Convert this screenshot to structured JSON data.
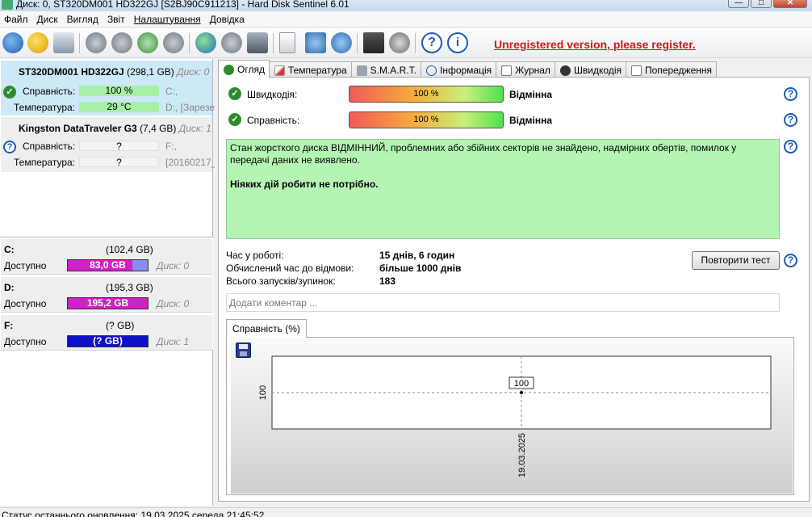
{
  "window": {
    "title": "Диск: 0, ST320DM001 HD322GJ [S2BJ90C911213]  -  Hard Disk Sentinel 6.01"
  },
  "menu": [
    "Файл",
    "Диск",
    "Вигляд",
    "Звіт",
    "Налаштування",
    "Довідка"
  ],
  "toolbar": {
    "icons": [
      "refresh-icon",
      "warning-icon",
      "disk-icon",
      "tools-icon",
      "tools2-icon",
      "tools-check-icon",
      "tools-settings-icon",
      "globe-icon",
      "tools-arrow-icon",
      "computer-icon",
      "report-icon",
      "transfer-icon",
      "network-icon",
      "benchmark-icon",
      "speaker-icon",
      "help-icon",
      "info-icon"
    ],
    "unregistered": "Unregistered version, please register."
  },
  "disks": [
    {
      "name": "ST320DM001 HD322GJ",
      "size": "(298,1 GB)",
      "disk_no": "Диск: 0",
      "health_label": "Справність:",
      "health_value": "100 %",
      "health_vol": "C:,",
      "temp_label": "Температура:",
      "temp_value": "29 °C",
      "temp_vol": "D:, [Зарезерв"
    },
    {
      "name": "Kingston DataTraveler G3",
      "size": "(7,4 GB)",
      "disk_no": "Диск: 1",
      "health_label": "Справність:",
      "health_value": "?",
      "health_vol": "F:,",
      "temp_label": "Температура:",
      "temp_value": "?",
      "temp_vol": "[20160217_"
    }
  ],
  "volumes": [
    {
      "name": "C:",
      "size": "(102,4 GB)",
      "avail_label": "Доступно",
      "avail": "83,0 GB",
      "disk": "Диск: 0",
      "color": "#d020c8",
      "fill": 0.81
    },
    {
      "name": "D:",
      "size": "(195,3 GB)",
      "avail_label": "Доступно",
      "avail": "195,2 GB",
      "disk": "Диск: 0",
      "color": "#d020c8",
      "fill": 1.0
    },
    {
      "name": "F:",
      "size": "(? GB)",
      "avail_label": "Доступно",
      "avail": "(? GB)",
      "disk": "Диск: 1",
      "color": "#1010c8",
      "fill": 0
    }
  ],
  "tabs": [
    "Огляд",
    "Температура",
    "S.M.A.R.T.",
    "Інформація",
    "Журнал",
    "Швидкодія",
    "Попередження"
  ],
  "overview": {
    "performance_label": "Швидкодія:",
    "performance_value": "100 %",
    "performance_pct": 100,
    "performance_rating": "Відмінна",
    "health_label": "Справність:",
    "health_value": "100 %",
    "health_pct": 100,
    "health_rating": "Відмінна",
    "status_text": "Стан жорсткого диска ВІДМІННИЙ, проблемних або збійних секторів не знайдено, надмірних обертів, помилок у передачі даних не виявлено.",
    "action_text": "Ніяких дій робити не потрібно.",
    "power_on_label": "Час у роботі:",
    "power_on_value": "15 днів, 6 годин",
    "est_life_label": "Обчислений час до відмови:",
    "est_life_value": "більше 1000 днів",
    "starts_label": "Всього запусків/зупинок:",
    "starts_value": "183",
    "retest_button": "Повторити тест",
    "comment_placeholder": "Додати коментар ..."
  },
  "chart_tab": "Справність (%)",
  "chart_data": {
    "type": "line",
    "x": [
      "19.03.2025"
    ],
    "series": [
      {
        "values": [
          100
        ]
      }
    ],
    "point_labels": [
      "100"
    ],
    "ytick_labels": [
      "100"
    ],
    "xtick_labels": [
      "19.03.2025"
    ],
    "grid": true
  },
  "statusbar": {
    "text": "Статус останнього оновлення: 19.03.2025 середа 21:45:52"
  }
}
